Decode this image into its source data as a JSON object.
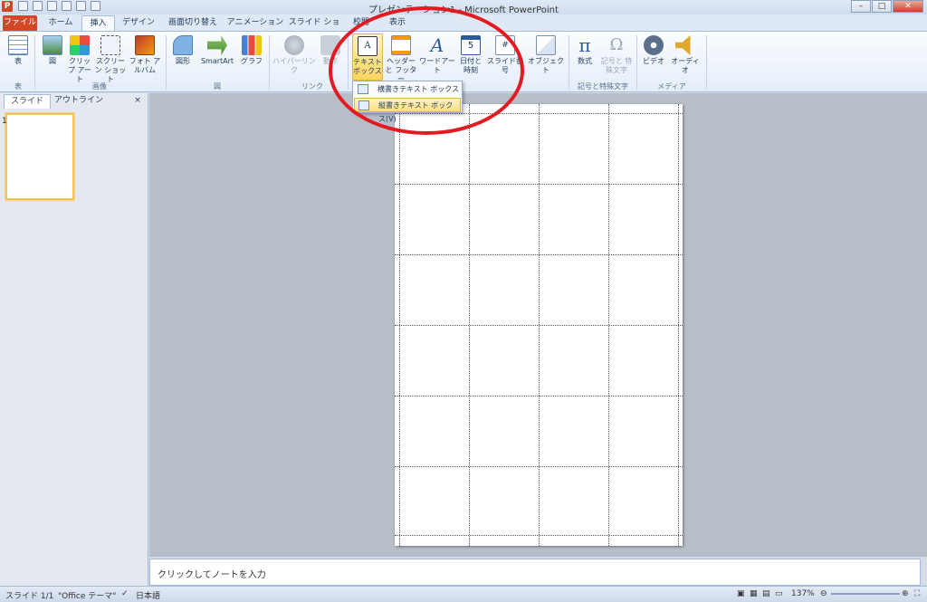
{
  "window": {
    "title": "プレゼンテーション1 - Microsoft PowerPoint",
    "app_icon": "P"
  },
  "tabs": [
    "ファイル",
    "ホーム",
    "挿入",
    "デザイン",
    "画面切り替え",
    "アニメーション",
    "スライド ショー",
    "校閲",
    "表示"
  ],
  "active_tab": "挿入",
  "ribbon": {
    "table": {
      "label": "表",
      "group": "表"
    },
    "picture": "図",
    "clipart": "クリップ アート",
    "screenshot": "スクリーン ショット",
    "photoalbum": "フォト アルバム",
    "images_group": "画像",
    "shapes": "図形",
    "smartart": "SmartArt",
    "chart": "グラフ",
    "illustrations_group": "図",
    "hyperlink": "ハイパーリンク",
    "action": "動作",
    "links_group": "リンク",
    "textbox": "テキスト ボックス",
    "header_footer": "ヘッダーと フッター",
    "wordart": "ワードアート",
    "datetime": "日付と 時刻",
    "slide_number": "スライド番号",
    "object": "オブジェクト",
    "equation": "数式",
    "symbol": "記号と 特殊文字",
    "symbols_group": "記号と特殊文字",
    "video": "ビデオ",
    "audio": "オーディオ",
    "media_group": "メディア"
  },
  "dropdown": {
    "horizontal": "横書きテキスト ボックス(H)",
    "vertical": "縦書きテキスト ボックス(V)"
  },
  "panel": {
    "tab_slides": "スライド",
    "tab_outline": "アウトライン",
    "close": "×",
    "thumb_number": "1"
  },
  "notes_placeholder": "クリックしてノートを入力",
  "status": {
    "slide": "スライド 1/1",
    "theme": "\"Office テーマ\"",
    "language": "日本語",
    "zoom": "137%"
  },
  "colors": {
    "accent": "#d24726",
    "highlight": "#ffd55c",
    "annotation": "#e21b23"
  }
}
